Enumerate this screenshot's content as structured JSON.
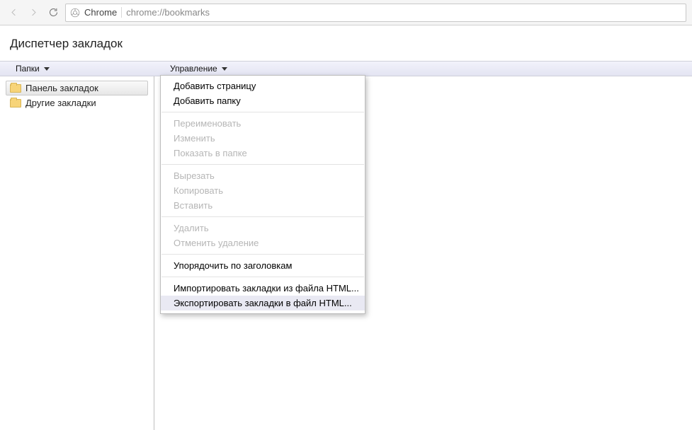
{
  "toolbar": {
    "brand": "Chrome",
    "url": "chrome://bookmarks"
  },
  "page": {
    "title": "Диспетчер закладок"
  },
  "headers": {
    "folders": "Папки",
    "manage": "Управление"
  },
  "sidebar": {
    "items": [
      {
        "label": "Панель закладок",
        "selected": true
      },
      {
        "label": "Другие закладки",
        "selected": false
      }
    ]
  },
  "menu": {
    "add_page": "Добавить страницу",
    "add_folder": "Добавить папку",
    "rename": "Переименовать",
    "edit": "Изменить",
    "show_in_folder": "Показать в папке",
    "cut": "Вырезать",
    "copy": "Копировать",
    "paste": "Вставить",
    "delete": "Удалить",
    "undo_delete": "Отменить удаление",
    "sort_by_title": "Упорядочить по заголовкам",
    "import_html": "Импортировать закладки из файла HTML...",
    "export_html": "Экспортировать закладки в файл HTML..."
  }
}
